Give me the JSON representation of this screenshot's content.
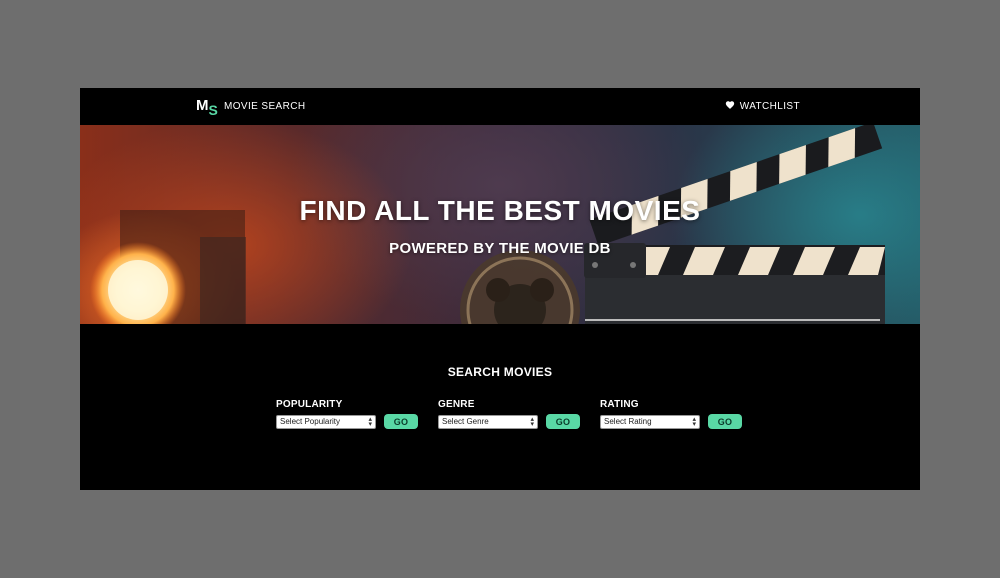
{
  "navbar": {
    "logo_m": "M",
    "logo_s": "S",
    "brand": "MOVIE SEARCH",
    "watchlist_label": "WATCHLIST",
    "watchlist_icon": "heart-icon"
  },
  "hero": {
    "title": "FIND ALL THE BEST MOVIES",
    "subtitle": "POWERED BY THE MOVIE DB"
  },
  "search": {
    "title": "SEARCH MOVIES",
    "filters": [
      {
        "label": "POPULARITY",
        "placeholder": "Select Popularity",
        "button": "GO"
      },
      {
        "label": "GENRE",
        "placeholder": "Select Genre",
        "button": "GO"
      },
      {
        "label": "RATING",
        "placeholder": "Select Rating",
        "button": "GO"
      }
    ]
  },
  "colors": {
    "accent": "#59d8a5",
    "background": "#000000",
    "page": "#6e6e6e"
  }
}
